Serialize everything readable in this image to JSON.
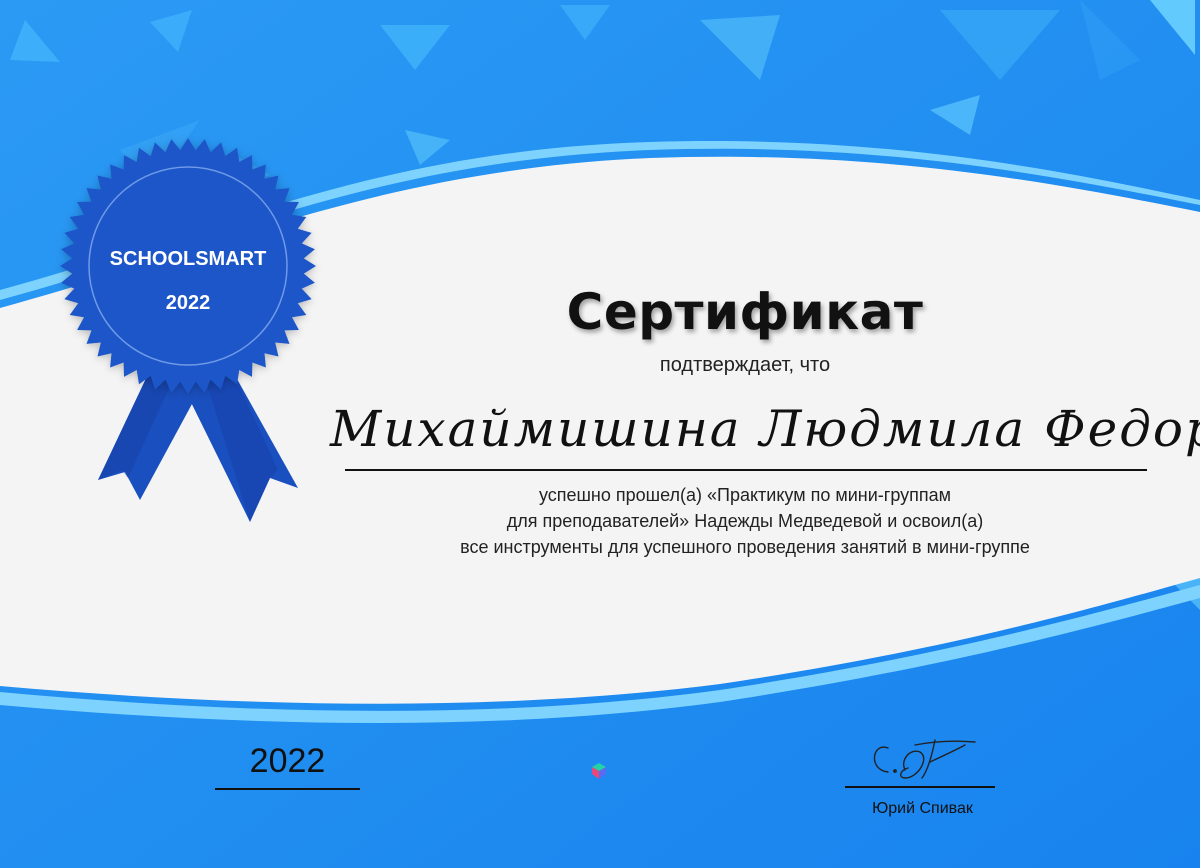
{
  "certificate": {
    "title": "Сертификат",
    "subtitle": "подтверждает, что",
    "recipient_name": "Михаймишина Людмила Федоровна",
    "body_lines": [
      "успешно прошел(а) «Практикум по мини-группам",
      "для преподавателей» Надежды Медведевой и освоил(а)",
      "все инструменты для успешного проведения занятий в мини-группе"
    ],
    "year": "2022",
    "signer_name": "Юрий Спивак"
  },
  "seal": {
    "brand": "SCHOOLSMART",
    "year": "2022"
  },
  "signature": {
    "text": "С. Ю"
  },
  "colors": {
    "frame_blue": "#1f8ef2",
    "accent_light_blue": "#62c4fb",
    "seal_blue": "#1c56c9",
    "ribbon_blue": "#1a4fbf",
    "paper": "#f4f4f4"
  },
  "icons": {
    "seal": "award-rosette-icon",
    "center_logo": "school-logo-icon",
    "signature": "handwritten-signature"
  }
}
